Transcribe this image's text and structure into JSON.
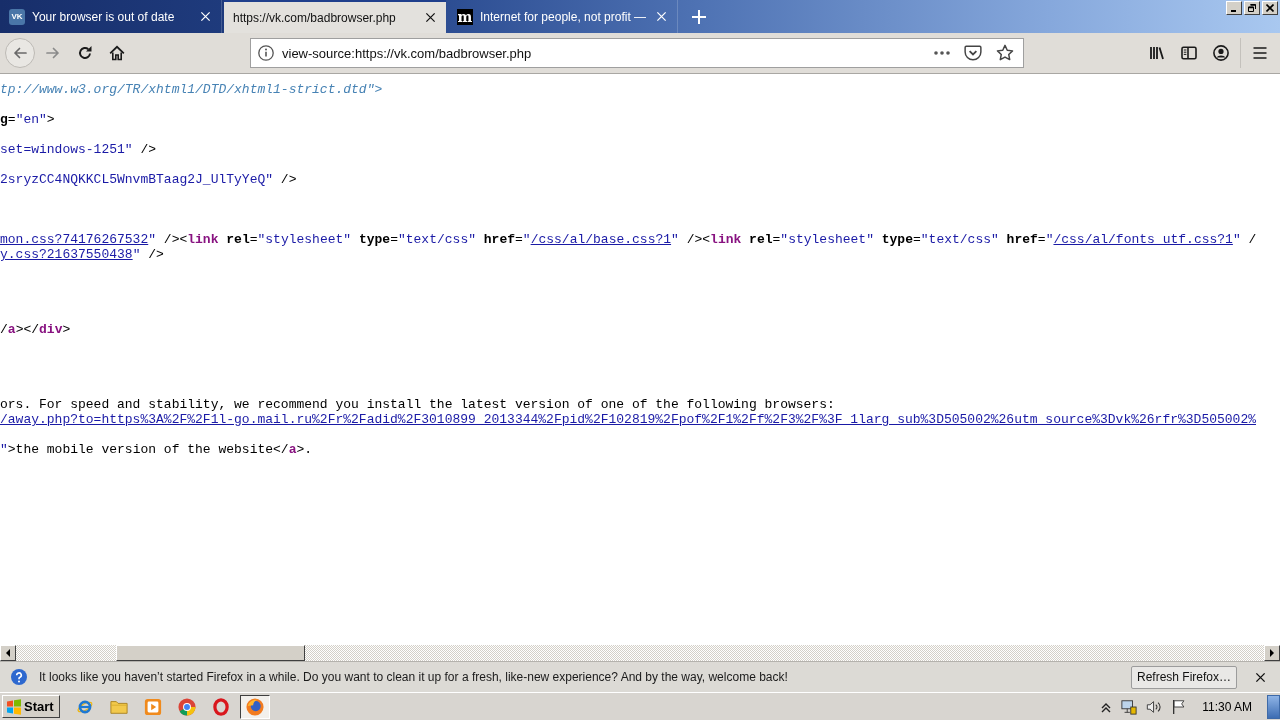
{
  "window": {
    "tabs": [
      {
        "title": "Your browser is out of date",
        "favicon": "VK",
        "selected": false
      },
      {
        "title": "https://vk.com/badbrowser.php",
        "selected": true
      },
      {
        "title": "Internet for people, not profit —",
        "favicon": "m",
        "selected": false
      }
    ]
  },
  "toolbar": {
    "url": "view-source:https://vk.com/badbrowser.php"
  },
  "source": {
    "lines": [
      {
        "kind": "code",
        "tokens": [
          {
            "kind": "doctype",
            "text": "tp://www.w3.org/TR/xhtml1/DTD/xhtml1-strict.dtd\">"
          }
        ]
      },
      {
        "kind": "blank"
      },
      {
        "kind": "code",
        "tokens": [
          {
            "kind": "attr",
            "text": "g"
          },
          {
            "kind": "text",
            "text": "="
          },
          {
            "kind": "value",
            "text": "\"en\""
          },
          {
            "kind": "text",
            "text": ">"
          }
        ]
      },
      {
        "kind": "blank"
      },
      {
        "kind": "code",
        "tokens": [
          {
            "kind": "value",
            "text": "set=windows-1251\""
          },
          {
            "kind": "text",
            "text": " />"
          }
        ]
      },
      {
        "kind": "blank"
      },
      {
        "kind": "code",
        "tokens": [
          {
            "kind": "value",
            "text": "2sryzCC4NQKKCL5WnvmBTaag2J_UlTyYeQ\""
          },
          {
            "kind": "text",
            "text": " />"
          }
        ]
      },
      {
        "kind": "blank"
      },
      {
        "kind": "blank"
      },
      {
        "kind": "blank"
      },
      {
        "kind": "code",
        "tokens": [
          {
            "kind": "link",
            "text": "mon.css?74176267532"
          },
          {
            "kind": "value",
            "text": "\""
          },
          {
            "kind": "text",
            "text": " /><"
          },
          {
            "kind": "tag",
            "text": "link"
          },
          {
            "kind": "attr",
            "text": " rel"
          },
          {
            "kind": "text",
            "text": "="
          },
          {
            "kind": "value",
            "text": "\"stylesheet\""
          },
          {
            "kind": "attr",
            "text": " type"
          },
          {
            "kind": "text",
            "text": "="
          },
          {
            "kind": "value",
            "text": "\"text/css\""
          },
          {
            "kind": "attr",
            "text": " href"
          },
          {
            "kind": "text",
            "text": "="
          },
          {
            "kind": "value",
            "text": "\""
          },
          {
            "kind": "link",
            "text": "/css/al/base.css?1"
          },
          {
            "kind": "value",
            "text": "\""
          },
          {
            "kind": "text",
            "text": " /><"
          },
          {
            "kind": "tag",
            "text": "link"
          },
          {
            "kind": "attr",
            "text": " rel"
          },
          {
            "kind": "text",
            "text": "="
          },
          {
            "kind": "value",
            "text": "\"stylesheet\""
          },
          {
            "kind": "attr",
            "text": " type"
          },
          {
            "kind": "text",
            "text": "="
          },
          {
            "kind": "value",
            "text": "\"text/css\""
          },
          {
            "kind": "attr",
            "text": " href"
          },
          {
            "kind": "text",
            "text": "="
          },
          {
            "kind": "value",
            "text": "\""
          },
          {
            "kind": "link",
            "text": "/css/al/fonts_utf.css?1"
          },
          {
            "kind": "value",
            "text": "\""
          },
          {
            "kind": "text",
            "text": " /"
          }
        ]
      },
      {
        "kind": "code",
        "tokens": [
          {
            "kind": "link",
            "text": "y.css?21637550438"
          },
          {
            "kind": "value",
            "text": "\""
          },
          {
            "kind": "text",
            "text": " />"
          }
        ]
      },
      {
        "kind": "blank"
      },
      {
        "kind": "blank"
      },
      {
        "kind": "blank"
      },
      {
        "kind": "blank"
      },
      {
        "kind": "code",
        "tokens": [
          {
            "kind": "text",
            "text": "/"
          },
          {
            "kind": "tag",
            "text": "a"
          },
          {
            "kind": "text",
            "text": "></"
          },
          {
            "kind": "tag",
            "text": "div"
          },
          {
            "kind": "text",
            "text": ">"
          }
        ]
      },
      {
        "kind": "blank"
      },
      {
        "kind": "blank"
      },
      {
        "kind": "blank"
      },
      {
        "kind": "blank"
      },
      {
        "kind": "code",
        "tokens": [
          {
            "kind": "text",
            "text": "ors. For speed and stability, we recommend you install the latest version of one of the following browsers:"
          }
        ]
      },
      {
        "kind": "code",
        "tokens": [
          {
            "kind": "link",
            "text": "/away.php?to=https%3A%2F%2F1l-go.mail.ru%2Fr%2Fadid%2F3010899_2013344%2Fpid%2F102819%2Fpof%2F1%2Ff%2F3%2F%3F_1larg_sub%3D505002%26utm_source%3Dvk%26rfr%3D505002%"
          }
        ]
      },
      {
        "kind": "blank"
      },
      {
        "kind": "code",
        "tokens": [
          {
            "kind": "value",
            "text": "\""
          },
          {
            "kind": "text",
            "text": ">the mobile version of the website</"
          },
          {
            "kind": "tag",
            "text": "a"
          },
          {
            "kind": "text",
            "text": ">."
          }
        ]
      }
    ]
  },
  "notification": {
    "message": "It looks like you haven’t started Firefox in a while. Do you want to clean it up for a fresh, like-new experience? And by the way, welcome back!",
    "button": "Refresh Firefox…"
  },
  "taskbar": {
    "start": "Start",
    "buttons": [
      {
        "selected": false
      },
      {
        "selected": false
      },
      {
        "selected": false
      },
      {
        "selected": false
      },
      {
        "selected": false
      },
      {
        "selected": true
      }
    ],
    "clock": "11:30 AM"
  }
}
